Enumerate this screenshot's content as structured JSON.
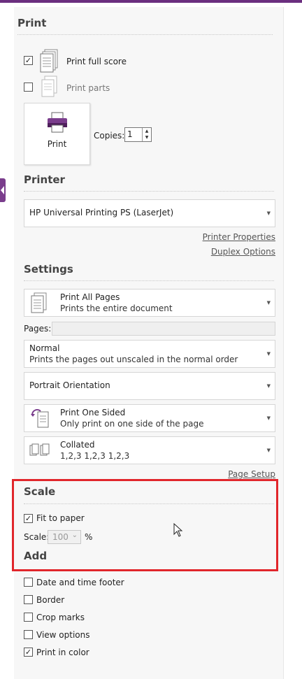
{
  "print": {
    "heading": "Print",
    "print_full_score": {
      "label": "Print full score",
      "checked": true
    },
    "print_parts": {
      "label": "Print parts",
      "checked": false
    },
    "print_button_label": "Print",
    "copies_label": "Copies:",
    "copies_value": "1"
  },
  "printer": {
    "heading": "Printer",
    "selected": "HP Universal Printing PS (LaserJet)",
    "properties_link": "Printer Properties",
    "duplex_link": "Duplex Options"
  },
  "settings": {
    "heading": "Settings",
    "pages_range": {
      "title": "Print All Pages",
      "subtitle": "Prints the entire document"
    },
    "pages_label": "Pages:",
    "pages_value": "",
    "scaling": {
      "title": "Normal",
      "subtitle": "Prints the pages out unscaled in the normal order"
    },
    "orientation": "Portrait Orientation",
    "sides": {
      "title": "Print One Sided",
      "subtitle": "Only print on one side of the page"
    },
    "collation": {
      "title": "Collated",
      "subtitle": "1,2,3   1,2,3   1,2,3"
    },
    "page_setup_link": "Page Setup"
  },
  "scale": {
    "heading": "Scale",
    "fit_to_paper": {
      "label": "Fit to paper",
      "checked": true
    },
    "scale_label": "Scale:",
    "scale_value": "100",
    "percent": "%"
  },
  "add": {
    "heading": "Add",
    "options": [
      {
        "label": "Date and time footer",
        "checked": false
      },
      {
        "label": "Border",
        "checked": false
      },
      {
        "label": "Crop marks",
        "checked": false
      },
      {
        "label": "View options",
        "checked": false
      },
      {
        "label": "Print in color",
        "checked": true
      }
    ]
  },
  "colors": {
    "accent": "#6b2f7f",
    "highlight_box": "#e1262b"
  }
}
